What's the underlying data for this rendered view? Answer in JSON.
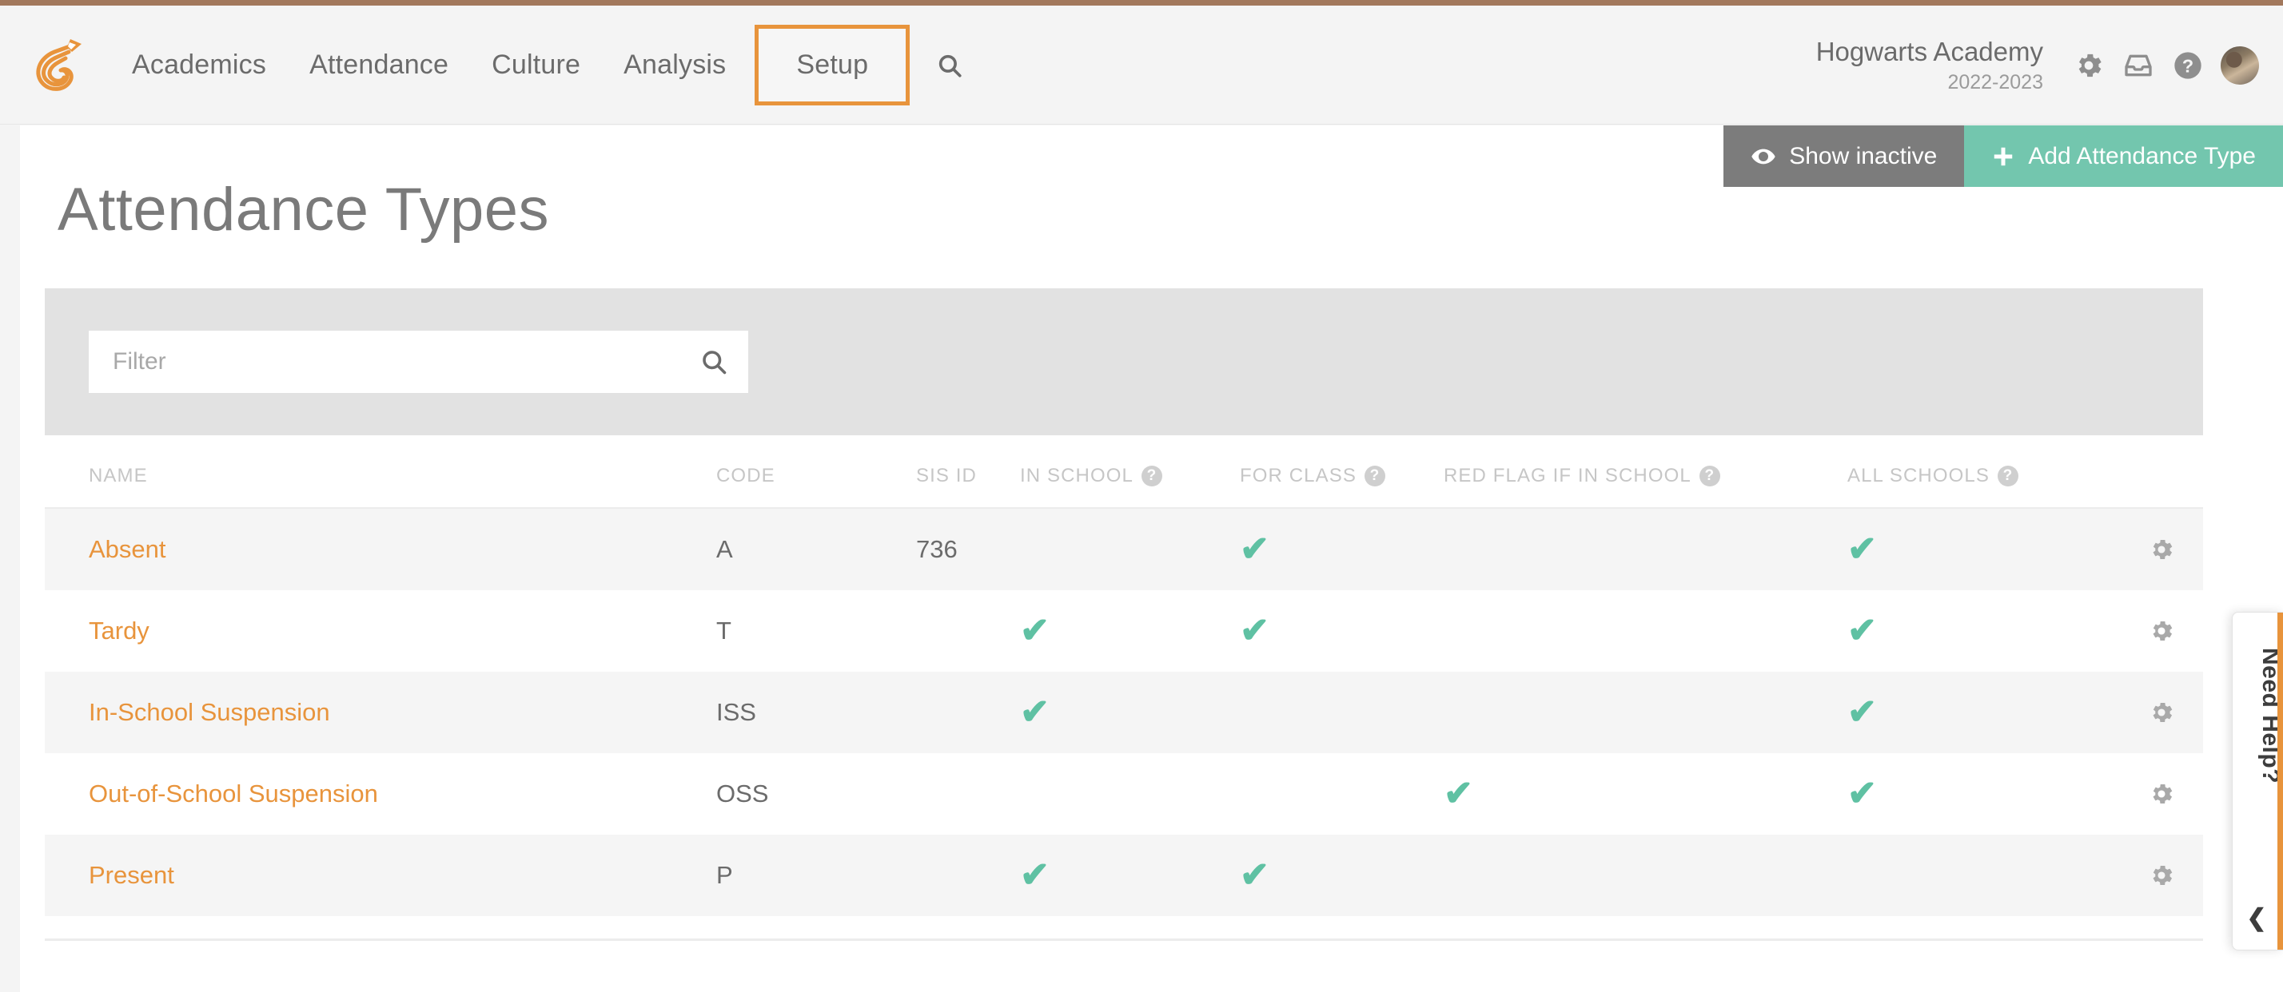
{
  "theme": {
    "accent_orange": "#e8943c",
    "top_bar_brown": "#a2785c",
    "teal": "#73c6ae",
    "gray_button": "#7c7c7c",
    "check_green": "#5fc1a3",
    "text_gray": "#6b6b6b"
  },
  "header": {
    "logo_name": "spiral-pencil-logo",
    "nav": [
      {
        "label": "Academics",
        "active": false
      },
      {
        "label": "Attendance",
        "active": false
      },
      {
        "label": "Culture",
        "active": false
      },
      {
        "label": "Analysis",
        "active": false
      },
      {
        "label": "Setup",
        "active": true
      }
    ],
    "search_icon": "search-icon",
    "school_name": "Hogwarts Academy",
    "school_year": "2022-2023",
    "icons": [
      {
        "name": "gear-icon"
      },
      {
        "name": "inbox-icon"
      },
      {
        "name": "help-circle-icon"
      },
      {
        "name": "avatar"
      }
    ]
  },
  "actions": {
    "show_inactive_label": "Show inactive",
    "show_inactive_icon": "eye-icon",
    "add_label": "Add Attendance Type",
    "add_icon": "plus-icon"
  },
  "page": {
    "title": "Attendance Types"
  },
  "filter": {
    "placeholder": "Filter",
    "value": "",
    "search_icon": "search-icon"
  },
  "table": {
    "columns": [
      {
        "key": "name",
        "label": "NAME",
        "help": false
      },
      {
        "key": "code",
        "label": "CODE",
        "help": false
      },
      {
        "key": "sis_id",
        "label": "SIS ID",
        "help": false
      },
      {
        "key": "in_school",
        "label": "IN SCHOOL",
        "help": true
      },
      {
        "key": "for_class",
        "label": "FOR CLASS",
        "help": true
      },
      {
        "key": "red_flag",
        "label": "RED FLAG IF IN SCHOOL",
        "help": true
      },
      {
        "key": "all_schools",
        "label": "ALL SCHOOLS",
        "help": true
      }
    ],
    "help_glyph": "?",
    "check_glyph": "✔",
    "rows": [
      {
        "name": "Absent",
        "code": "A",
        "sis_id": "736",
        "in_school": false,
        "for_class": true,
        "red_flag": false,
        "all_schools": true,
        "gear": "gear-icon"
      },
      {
        "name": "Tardy",
        "code": "T",
        "sis_id": "",
        "in_school": true,
        "for_class": true,
        "red_flag": false,
        "all_schools": true,
        "gear": "gear-icon"
      },
      {
        "name": "In-School Suspension",
        "code": "ISS",
        "sis_id": "",
        "in_school": true,
        "for_class": false,
        "red_flag": false,
        "all_schools": true,
        "gear": "gear-icon"
      },
      {
        "name": "Out-of-School Suspension",
        "code": "OSS",
        "sis_id": "",
        "in_school": false,
        "for_class": false,
        "red_flag": true,
        "all_schools": true,
        "gear": "gear-icon"
      },
      {
        "name": "Present",
        "code": "P",
        "sis_id": "",
        "in_school": true,
        "for_class": true,
        "red_flag": false,
        "all_schools": false,
        "gear": "gear-icon"
      }
    ]
  },
  "need_help": {
    "label": "Need Help?",
    "chevron": "❮"
  }
}
